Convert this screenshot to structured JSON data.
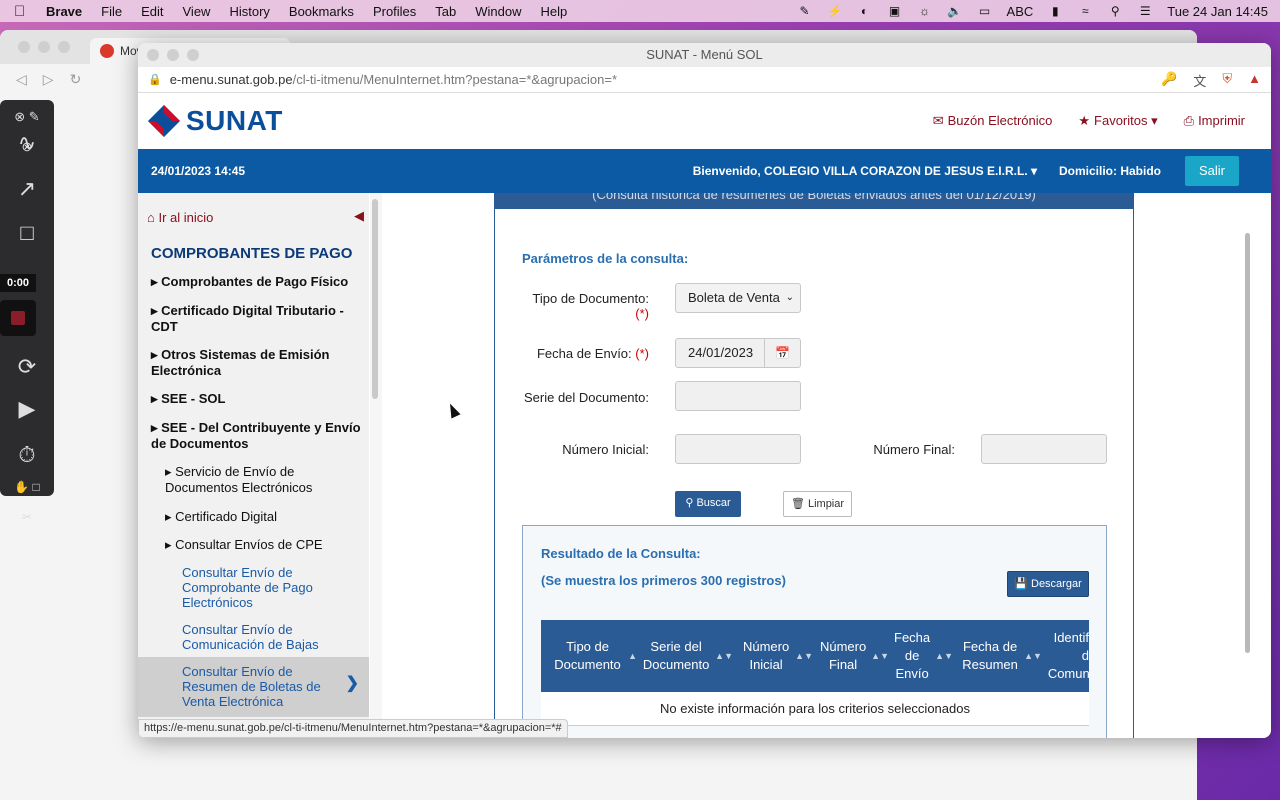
{
  "menubar": {
    "app": "Brave",
    "items": [
      "File",
      "Edit",
      "View",
      "History",
      "Bookmarks",
      "Profiles",
      "Tab",
      "Window",
      "Help"
    ],
    "input_source": "ABC",
    "datetime": "Tue 24 Jan  14:45"
  },
  "bg_browser": {
    "tab_title": "Movim"
  },
  "drawbar": {
    "timer": "0:00"
  },
  "window": {
    "title": "SUNAT - Menú SOL",
    "url_host": "e-menu.sunat.gob.pe",
    "url_path": "/cl-ti-itmenu/MenuInternet.htm?pestana=*&agrupacion=*"
  },
  "header": {
    "logo": "SUNAT",
    "links": {
      "buzon": "Buzón Electrónico",
      "favoritos": "Favoritos",
      "imprimir": "Imprimir"
    }
  },
  "bluebar": {
    "date": "24/01/2023 14:45",
    "welcome": "Bienvenido, COLEGIO VILLA CORAZON DE JESUS E.I.R.L.",
    "domicilio": "Domicilio: Habido",
    "salir": "Salir"
  },
  "sidebar": {
    "home": "Ir al inicio",
    "heading": "COMPROBANTES DE PAGO",
    "items": [
      "Comprobantes de Pago Físico",
      "Certificado Digital Tributario - CDT",
      "Otros Sistemas de Emisión Electrónica",
      "SEE - SOL",
      "SEE - Del Contribuyente y Envío de Documentos"
    ],
    "sub_items": [
      "Servicio de Envío de Documentos Electrónicos",
      "Certificado Digital",
      "Consultar Envíos de CPE"
    ],
    "leaf_items": [
      "Consultar Envío de Comprobante de Pago Electrónicos",
      "Consultar Envío de Comunicación de Bajas",
      "Consultar Envío de Resumen de Boletas de Venta Electrónica"
    ]
  },
  "form": {
    "panel_top": "(Consulta histórica de resúmenes de Boletas enviados antes del 01/12/2019)",
    "title": "Parámetros de la consulta:",
    "tipo_label": "Tipo de Documento:",
    "tipo_value": "Boleta de Venta",
    "fecha_label": "Fecha de Envío:",
    "fecha_value": "24/01/2023",
    "serie_label": "Serie del Documento:",
    "num_ini_label": "Número Inicial:",
    "num_fin_label": "Número Final:",
    "required_mark": "(*)",
    "buscar": "Buscar",
    "limpiar": "Limpiar"
  },
  "results": {
    "title": "Resultado de la Consulta:",
    "subtitle": "(Se muestra los primeros 300 registros)",
    "descargar": "Descargar",
    "columns": [
      "Tipo de Documento",
      "Serie del Documento",
      "Número Inicial",
      "Número Final",
      "Fecha de Envío",
      "Fecha de Resumen",
      "Identificador de Comunicación"
    ],
    "empty": "No existe información para los criterios seleccionados"
  },
  "statusbar": "https://e-menu.sunat.gob.pe/cl-ti-itmenu/MenuInternet.htm?pestana=*&agrupacion=*#"
}
